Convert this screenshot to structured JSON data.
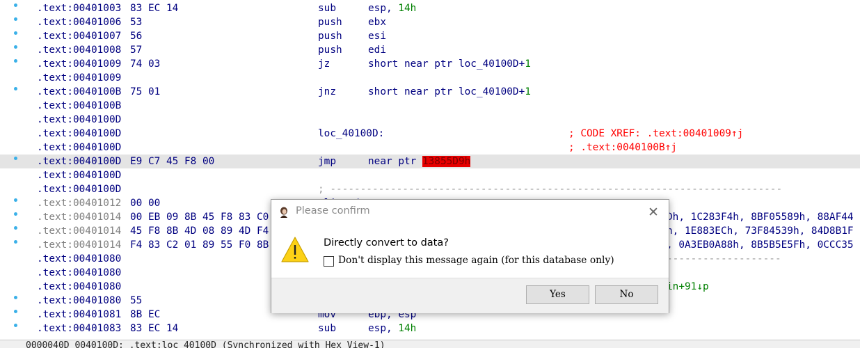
{
  "listing": [
    {
      "addr": ".text:00401003",
      "bytes": "83 EC 14",
      "mnem": "sub",
      "ops": "esp, ",
      "num": "14h",
      "bullet": true
    },
    {
      "addr": ".text:00401006",
      "bytes": "53",
      "mnem": "push",
      "ops": "ebx",
      "bullet": true
    },
    {
      "addr": ".text:00401007",
      "bytes": "56",
      "mnem": "push",
      "ops": "esi",
      "bullet": true
    },
    {
      "addr": ".text:00401008",
      "bytes": "57",
      "mnem": "push",
      "ops": "edi",
      "bullet": true
    },
    {
      "addr": ".text:00401009",
      "bytes": "74 03",
      "mnem": "jz",
      "ops": "short near ptr loc_40100D+",
      "num": "1",
      "bullet": true
    },
    {
      "addr": ".text:00401009"
    },
    {
      "addr": ".text:0040100B",
      "bytes": "75 01",
      "mnem": "jnz",
      "ops": "short near ptr loc_40100D+",
      "num": "1",
      "bullet": true
    },
    {
      "addr": ".text:0040100B"
    },
    {
      "addr": ".text:0040100D"
    },
    {
      "addr": ".text:0040100D",
      "loc": "loc_40100D:",
      "cmt": "; CODE XREF: .text:00401009↑j"
    },
    {
      "addr": ".text:0040100D",
      "cmt": "; .text:0040100B↑j"
    },
    {
      "addr": ".text:0040100D",
      "bytes": "E9 C7 45 F8 00",
      "mnem": "jmp",
      "ops": "near ptr ",
      "redop": "13855D9h",
      "bullet": true,
      "hl": true
    },
    {
      "addr": ".text:0040100D"
    },
    {
      "addr": ".text:0040100D",
      "sep": "; ---------------------------------------------------------------------------"
    },
    {
      "addr": ".text:00401012",
      "bytes": "00 00",
      "dim": true,
      "bullet": true,
      "loc": "align 4"
    },
    {
      "addr": ".text:00401014",
      "bytes": "00 EB 09 8B 45 F8 83 C0",
      "dim": true,
      "bullet": true,
      "datav": "Dh, 1C283F4h, 8BF05589h, 88AF44"
    },
    {
      "addr": ".text:00401014",
      "bytes": "45 F8 8B 4D 08 89 4D F4",
      "dim": true,
      "bullet": true,
      "datav": "h, 1E883ECh, 73F84539h, 84D8B1F"
    },
    {
      "addr": ".text:00401014",
      "bytes": "F4 83 C2 01 89 55 F0 8B",
      "dim": true,
      "bullet": true,
      "datav": ", 0A3EB0A88h, 8B5B5E5Fh, 0CCC35"
    },
    {
      "addr": ".text:00401080",
      "sepv": "-------------------"
    },
    {
      "addr": ".text:00401080"
    },
    {
      "addr": ".text:00401080",
      "greenv": "in+91↓p"
    },
    {
      "addr": ".text:00401080",
      "bytes": "55",
      "bullet": true
    },
    {
      "addr": ".text:00401081",
      "bytes": "8B EC",
      "mnem": "mov",
      "ops": "ebp, esp",
      "bullet": true
    },
    {
      "addr": ".text:00401083",
      "bytes": "83 EC 14",
      "mnem": "sub",
      "ops": "esp, ",
      "num": "14h",
      "bullet": true
    }
  ],
  "status_bar": {
    "text": "0000040D 0040100D: .text:loc_40100D (Synchronized with Hex View-1)"
  },
  "dialog": {
    "title": "Please confirm",
    "message": "Directly convert to data?",
    "checkbox_label": "Don't display this message again (for this database only)",
    "checkbox_checked": false,
    "yes_label": "Yes",
    "no_label": "No",
    "icon": "warning-icon"
  }
}
